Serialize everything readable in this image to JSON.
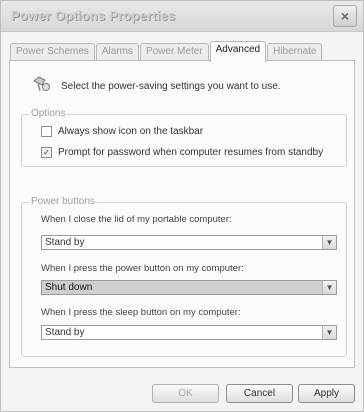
{
  "window": {
    "title": "Power Options Properties",
    "close_label": "×"
  },
  "tabs": [
    {
      "label": "Power Schemes",
      "active": false
    },
    {
      "label": "Alarms",
      "active": false
    },
    {
      "label": "Power Meter",
      "active": false
    },
    {
      "label": "Advanced",
      "active": true
    },
    {
      "label": "Hibernate",
      "active": false
    }
  ],
  "intro": {
    "icon": "power-settings-icon",
    "text": "Select the power-saving settings you want to use."
  },
  "options": {
    "label": "Options",
    "always_show_icon": {
      "label": "Always show icon on the taskbar",
      "checked": false
    },
    "prompt_password": {
      "label": "Prompt for password when computer resumes from standby",
      "checked": true
    }
  },
  "power_buttons": {
    "label": "Power buttons",
    "lid": {
      "label": "When I close the lid of my portable computer:",
      "value": "Stand by"
    },
    "power_button": {
      "label": "When I press the power button on my computer:",
      "value": "Shut down"
    },
    "sleep_button": {
      "label": "When I press the sleep button on my computer:",
      "value": "Stand by"
    }
  },
  "buttons": {
    "ok": "OK",
    "cancel": "Cancel",
    "apply": "Apply"
  }
}
